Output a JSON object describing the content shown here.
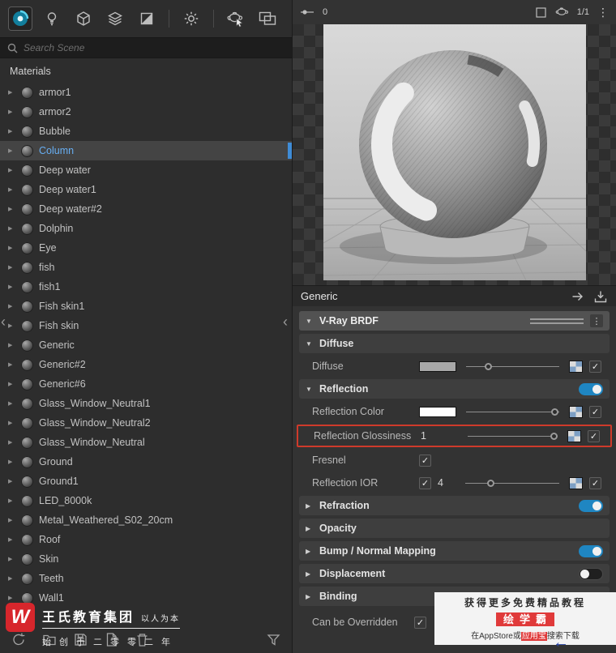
{
  "left_panel": {
    "toolbar_icons": [
      "vray-materials-icon",
      "lights-icon",
      "geometry-icon",
      "layers-icon",
      "textures-icon",
      "settings-gear-icon",
      "render-teapot-icon",
      "frame-buffer-icon"
    ],
    "search_placeholder": "Search Scene",
    "section_title": "Materials",
    "materials": [
      {
        "name": "armor1"
      },
      {
        "name": "armor2"
      },
      {
        "name": "Bubble"
      },
      {
        "name": "Column",
        "selected": true
      },
      {
        "name": "Deep water"
      },
      {
        "name": "Deep water1"
      },
      {
        "name": "Deep water#2"
      },
      {
        "name": "Dolphin"
      },
      {
        "name": "Eye"
      },
      {
        "name": "fish"
      },
      {
        "name": "fish1"
      },
      {
        "name": "Fish skin1"
      },
      {
        "name": "Fish skin"
      },
      {
        "name": "Generic"
      },
      {
        "name": "Generic#2"
      },
      {
        "name": "Generic#6"
      },
      {
        "name": "Glass_Window_Neutral1"
      },
      {
        "name": "Glass_Window_Neutral2"
      },
      {
        "name": "Glass_Window_Neutral"
      },
      {
        "name": "Ground"
      },
      {
        "name": "Ground1"
      },
      {
        "name": "LED_8000k"
      },
      {
        "name": "Metal_Weathered_S02_20cm"
      },
      {
        "name": "Roof"
      },
      {
        "name": "Skin"
      },
      {
        "name": "Teeth"
      },
      {
        "name": "Wall1"
      }
    ],
    "bottom_toolbar_icons": [
      "refresh-icon",
      "open-folder-icon",
      "save-icon",
      "new-document-icon",
      "trash-icon",
      "filter-funnel-icon"
    ]
  },
  "right_panel": {
    "toolbar": {
      "left_value": "0",
      "page_indicator": "1/1"
    },
    "asset_header": {
      "title": "Generic"
    },
    "brdf": {
      "label": "V-Ray BRDF"
    },
    "sections": {
      "diffuse": {
        "label": "Diffuse",
        "row": {
          "label": "Diffuse",
          "swatch": "#a8a8a8",
          "slider": 0.24,
          "checked": true
        }
      },
      "reflection": {
        "label": "Reflection",
        "enabled": true,
        "color_row": {
          "label": "Reflection Color",
          "swatch": "#ffffff",
          "slider": 0.96,
          "checked": true
        },
        "glossiness_row": {
          "label": "Reflection Glossiness",
          "value": "1",
          "slider": 0.96,
          "checked": true
        },
        "fresnel_row": {
          "label": "Fresnel",
          "checked": true
        },
        "ior_row": {
          "label": "Reflection IOR",
          "use_checked": true,
          "value": "4",
          "slider": 0.28,
          "checked": true
        }
      },
      "refraction": {
        "label": "Refraction",
        "enabled": true
      },
      "opacity": {
        "label": "Opacity"
      },
      "bump": {
        "label": "Bump / Normal Mapping",
        "enabled": true
      },
      "displacement": {
        "label": "Displacement",
        "enabled": false
      },
      "binding": {
        "label": "Binding"
      }
    },
    "override_row": {
      "label": "Can be Overridden",
      "checked": true
    }
  },
  "watermarks": {
    "brand": {
      "logo_letter": "W",
      "title": "王氏教育集团",
      "slogan": "以人为本",
      "footnote": "始创于二零零二年"
    },
    "promo": {
      "line1": "获得更多免费精品教程",
      "line2": "绘学霸",
      "line3_prefix": "在AppStore或",
      "line3_highlight": "应用宝",
      "line3_suffix": "搜索下载"
    }
  },
  "colors": {
    "accent_blue": "#1f86c2",
    "selection_text": "#67aef2",
    "annotation_red": "#cf3a2b",
    "brand_red": "#d7262c"
  }
}
